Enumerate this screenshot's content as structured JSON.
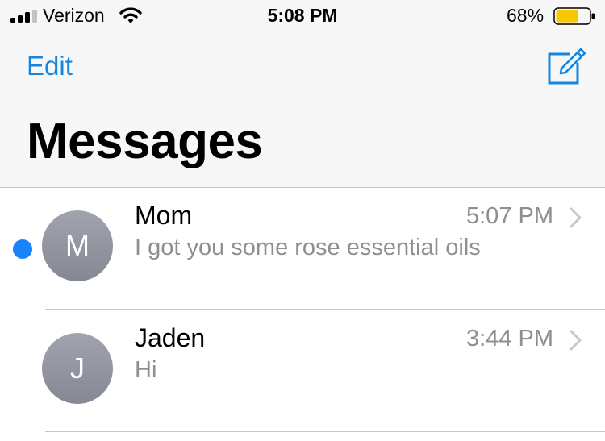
{
  "status_bar": {
    "carrier": "Verizon",
    "time": "5:08 PM",
    "battery_percent": "68%",
    "battery_level": 0.68,
    "battery_color": "#f7c700",
    "signal_bars_filled": 3,
    "signal_bars_total": 4,
    "icons": [
      "signal-icon",
      "wifi-icon",
      "battery-icon"
    ]
  },
  "nav": {
    "edit_label": "Edit",
    "title": "Messages",
    "compose_icon": "compose-icon",
    "accent_color": "#1486e0"
  },
  "conversations": [
    {
      "initial": "M",
      "name": "Mom",
      "time": "5:07 PM",
      "preview": "I got you some rose essential oils",
      "unread": true,
      "unread_color": "#1a82fb"
    },
    {
      "initial": "J",
      "name": "Jaden",
      "time": "3:44 PM",
      "preview": "Hi",
      "unread": false
    }
  ]
}
